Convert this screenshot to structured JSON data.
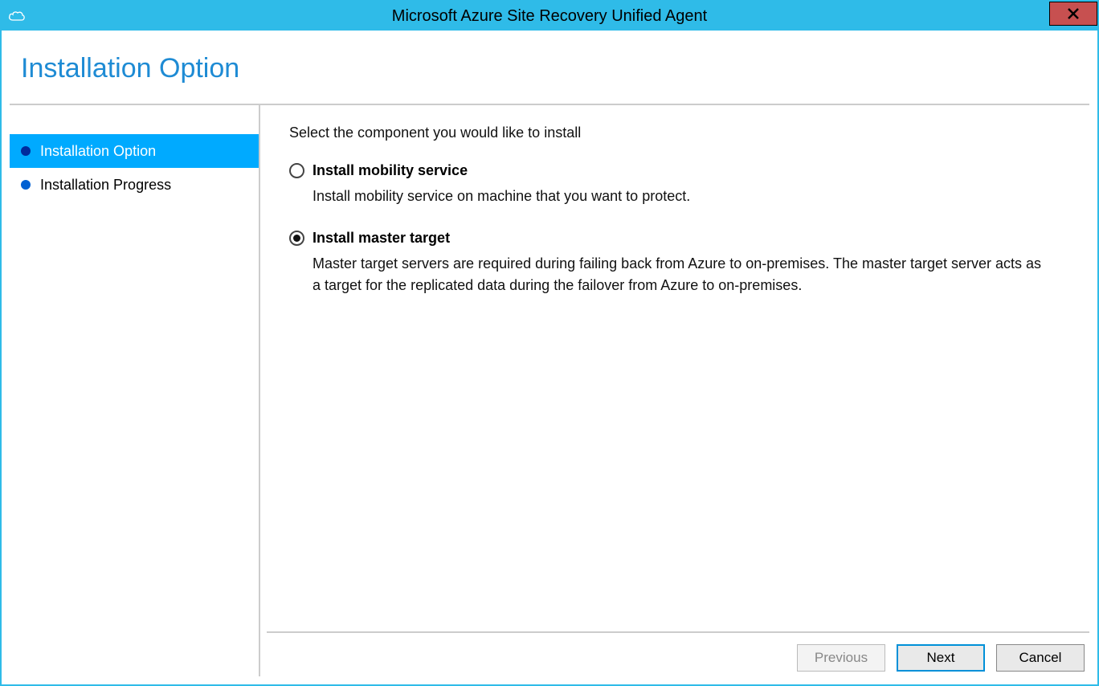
{
  "window": {
    "title": "Microsoft Azure Site Recovery Unified Agent"
  },
  "header": {
    "title": "Installation Option"
  },
  "sidebar": {
    "items": [
      {
        "label": "Installation Option",
        "active": true
      },
      {
        "label": "Installation Progress",
        "active": false
      }
    ]
  },
  "main": {
    "intro": "Select the component you would like to install",
    "options": [
      {
        "label": "Install mobility service",
        "description": "Install mobility service on machine that you want to protect.",
        "selected": false
      },
      {
        "label": "Install master target",
        "description": "Master target servers are required during failing back from Azure to on-premises. The master target server acts as a target for the replicated data during the failover from Azure to on-premises.",
        "selected": true
      }
    ]
  },
  "footer": {
    "previous": "Previous",
    "next": "Next",
    "cancel": "Cancel",
    "previous_enabled": false
  }
}
